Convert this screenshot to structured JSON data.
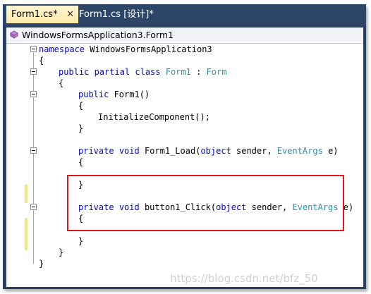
{
  "tabs": [
    {
      "label": "Form1.cs*",
      "active": true,
      "close": "✕"
    },
    {
      "label": "Form1.cs [设计]*",
      "active": false
    }
  ],
  "navbar": {
    "class_path": "WindowsFormsApplication3.Form1",
    "icon": "class-icon"
  },
  "code": {
    "l1_kw": "namespace",
    "l1_rest": " WindowsFormsApplication3",
    "l2": "{",
    "l3_kw": "public partial class",
    "l3_sp": " ",
    "l3_type": "Form1",
    "l3_colon": " : ",
    "l3_base": "Form",
    "l4": "{",
    "l5_kw": "public",
    "l5_rest": " Form1()",
    "l6": "{",
    "l7": "InitializeComponent();",
    "l8": "}",
    "l9_kw1": "private",
    "l9_kw2": "void",
    "l9_name": " Form1_Load(",
    "l9_kw3": "object",
    "l9_mid": " sender, ",
    "l9_type": "EventArgs",
    "l9_end": " e)",
    "l10": "{",
    "l11": "}",
    "l12_kw1": "private",
    "l12_kw2": "void",
    "l12_name": " button1_Click(",
    "l12_kw3": "object",
    "l12_mid": " sender, ",
    "l12_type": "EventArgs",
    "l12_end": " e)",
    "l13": "{",
    "l14": "}",
    "l15": "}",
    "l16": "}"
  },
  "watermark": "https://blog.csdn.net/bfz_50",
  "colors": {
    "keyword": "#0000ff",
    "type": "#2b91af",
    "highlight": "#e8141a",
    "tab_active": "#ffe9a8",
    "frame": "#29405f"
  }
}
